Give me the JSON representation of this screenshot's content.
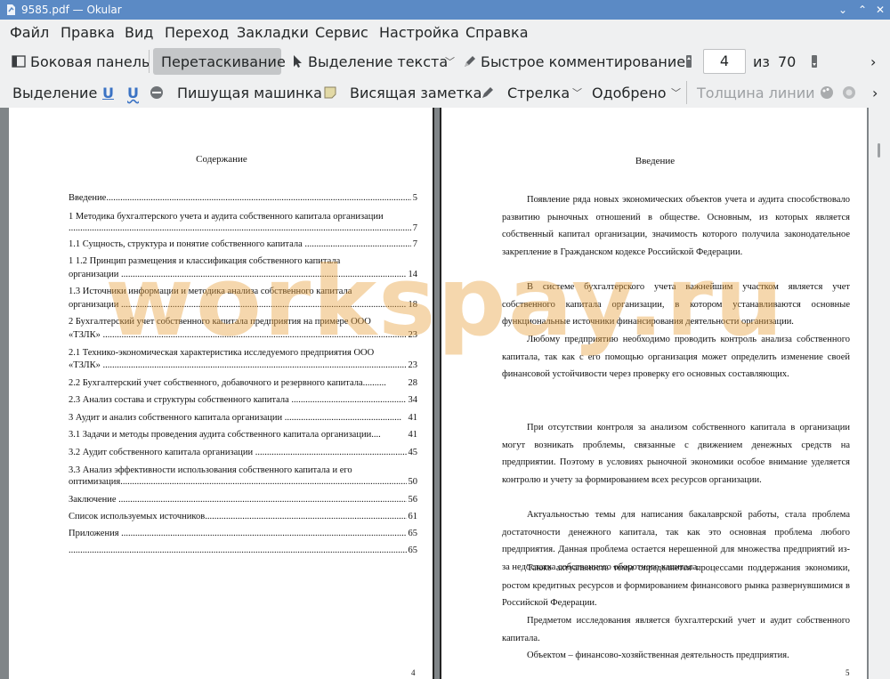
{
  "window": {
    "title": "9585.pdf  — Okular",
    "minimize": "⌄",
    "maximize": "⌃",
    "close": "✕"
  },
  "menu": [
    "Файл",
    "Правка",
    "Вид",
    "Переход",
    "Закладки",
    "Сервис",
    "Настройка",
    "Справка"
  ],
  "toolbar1": {
    "sidebar": "Боковая панель",
    "drag": "Перетаскивание",
    "text_select": "Выделение текста",
    "quick_comment": "Быстрое комментирование",
    "page_current": "4",
    "page_of": "из",
    "page_total": "70",
    "more": "›"
  },
  "toolbar2": {
    "selection": "Выделение",
    "typewriter": "Пишущая машинка",
    "sticky_note": "Висящая заметка",
    "arrow": "Стрелка",
    "stamp": "Одобрено",
    "line_width": "Толщина линии",
    "more": "›"
  },
  "left_page": {
    "title": "Содержание",
    "toc": [
      {
        "text": "Введение................................................................................................................................................",
        "page": "5"
      },
      {
        "text": "1 Методика бухгалтерского учета и аудита собственного капитала организации",
        "page": ""
      },
      {
        "text": "...........................................................................................................................................................",
        "page": "7"
      },
      {
        "text": "1.1 Сущность, структура и понятие собственного капитала ......................................................",
        "page": "7"
      },
      {
        "text": "1        1.2 Принцип размещения и классификация собственного капитала",
        "page": ""
      },
      {
        "text": "организации ...................................................................................................................................",
        "page": "14"
      },
      {
        "text": "1.3 Источники информации и методика анализа собственного капитала",
        "page": ""
      },
      {
        "text": "организации ...................................................................................................................................",
        "page": "18"
      },
      {
        "text": "2 Бухгалтерский учет собственного капитала предприятия на примере ООО",
        "page": ""
      },
      {
        "text": "«ТЗЛК» .............................................................................................................................................",
        "page": "23"
      },
      {
        "text": "2.1 Технико-экономическая характеристика исследуемого предприятия ООО",
        "page": ""
      },
      {
        "text": "«ТЗЛК» .............................................................................................................................................",
        "page": "23"
      },
      {
        "text": "2.2 Бухгалтерский учет собственного, добавочного и резервного капитала..........",
        "page": "28"
      },
      {
        "text": "2.3 Анализ состава и структуры собственного капитала .................................................",
        "page": "34"
      },
      {
        "text": "3 Аудит и анализ собственного капитала организации ..................................................",
        "page": "41"
      },
      {
        "text": "3.1 Задачи и методы проведения аудита собственного капитала организации....",
        "page": "41"
      },
      {
        "text": "3.2 Аудит собственного капитала организации ...................................................................",
        "page": "45"
      },
      {
        "text": "3.3 Анализ эффективности использования собственного капитала и его",
        "page": ""
      },
      {
        "text": "оптимизация....................................................................................................................................",
        "page": "50"
      },
      {
        "text": "Заключение ......................................................................................................................................",
        "page": "56"
      },
      {
        "text": "Список используемых источников........................................................................................",
        "page": "61"
      },
      {
        "text": "Приложения ....................................................................................................................................",
        "page": "65"
      },
      {
        "text": "...........................................................................................................................................................",
        "page": "65"
      }
    ],
    "footer": "4"
  },
  "right_page": {
    "title": "Введение",
    "paragraphs": [
      "Появление ряда новых экономических объектов учета и аудита способствовало развитию рыночных отношений в обществе. Основным, из которых является собственный капитал организации, значимость которого получила законодательное закрепление в Гражданском кодексе Российской Федерации.",
      "В системе бухгалтерского учета важнейшим участком является учет собственного капитала организации, в котором устанавливаются основные функциональные источники финансирования деятельности организации.",
      "Любому предприятию необходимо проводить контроль анализа собственного капитала, так как с его помощью организация может определить изменение своей финансовой устойчивости через проверку его основных составляющих.",
      "При отсутствии контроля за анализом собственного капитала в организации могут возникать проблемы, связанные с движением денежных средств на предприятии. Поэтому в условиях рыночной экономики особое внимание уделяется контролю и учету за формированием всех ресурсов организации.",
      "Актуальностью темы для написания бакалаврской работы, стала проблема достаточности денежного капитала, так как это основная проблема любого предприятия. Данная проблема остается нерешенной для множества предприятий из-за недостатка собственного оборотного капитала.",
      "Также актуальность темы определяется процессами поддержания экономики, ростом кредитных ресурсов и формированием финансового рынка развернувшимися в Российской Федерации.",
      "Предметом исследования является бухгалтерский учет и аудит собственного капитала.",
      "Объектом – финансово-хозяйственная деятельность предприятия."
    ],
    "footer": "5"
  },
  "watermark": "workspay.ru",
  "colors": {
    "titlebar": "#5b8ac5",
    "chrome": "#eff0f1",
    "doc_bg": "#808588",
    "watermark": "#e8a03c"
  }
}
